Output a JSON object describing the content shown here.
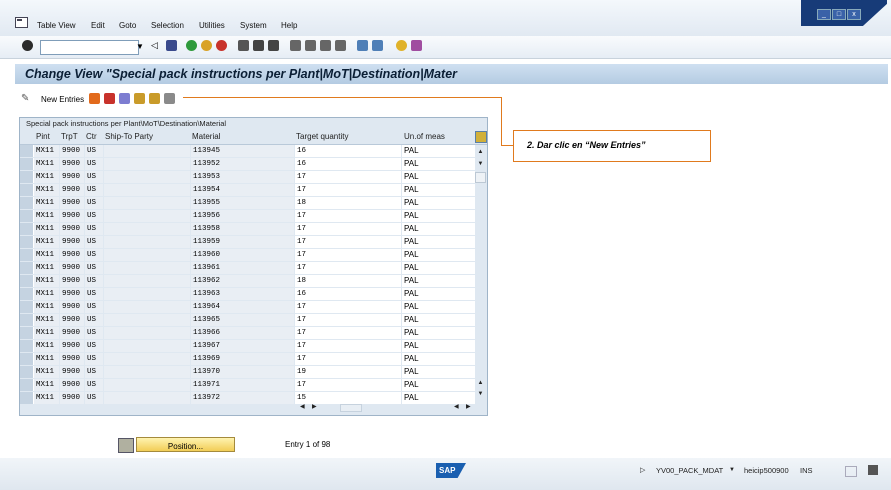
{
  "menu": [
    "Table View",
    "Edit",
    "Goto",
    "Selection",
    "Utilities",
    "System",
    "Help"
  ],
  "window_controls": [
    "_",
    "□",
    "x"
  ],
  "command_field": {
    "value": ""
  },
  "title": "Change View \"Special pack instructions per Plant|MoT|Destination|Mater",
  "app_toolbar": {
    "new_entries": "New Entries"
  },
  "table": {
    "title": "Special pack instructions per Plant\\MoT\\Destination\\Material",
    "columns": [
      "Pint",
      "TrpT",
      "Ctr",
      "Ship-To Party",
      "Material",
      "Target quantity",
      "Un.of meas"
    ],
    "rows": [
      [
        "MX11",
        "9900",
        "US",
        "",
        "113945",
        "16",
        "PAL"
      ],
      [
        "MX11",
        "9900",
        "US",
        "",
        "113952",
        "16",
        "PAL"
      ],
      [
        "MX11",
        "9900",
        "US",
        "",
        "113953",
        "17",
        "PAL"
      ],
      [
        "MX11",
        "9900",
        "US",
        "",
        "113954",
        "17",
        "PAL"
      ],
      [
        "MX11",
        "9900",
        "US",
        "",
        "113955",
        "18",
        "PAL"
      ],
      [
        "MX11",
        "9900",
        "US",
        "",
        "113956",
        "17",
        "PAL"
      ],
      [
        "MX11",
        "9900",
        "US",
        "",
        "113958",
        "17",
        "PAL"
      ],
      [
        "MX11",
        "9900",
        "US",
        "",
        "113959",
        "17",
        "PAL"
      ],
      [
        "MX11",
        "9900",
        "US",
        "",
        "113960",
        "17",
        "PAL"
      ],
      [
        "MX11",
        "9900",
        "US",
        "",
        "113961",
        "17",
        "PAL"
      ],
      [
        "MX11",
        "9900",
        "US",
        "",
        "113962",
        "18",
        "PAL"
      ],
      [
        "MX11",
        "9900",
        "US",
        "",
        "113963",
        "16",
        "PAL"
      ],
      [
        "MX11",
        "9900",
        "US",
        "",
        "113964",
        "17",
        "PAL"
      ],
      [
        "MX11",
        "9900",
        "US",
        "",
        "113965",
        "17",
        "PAL"
      ],
      [
        "MX11",
        "9900",
        "US",
        "",
        "113966",
        "17",
        "PAL"
      ],
      [
        "MX11",
        "9900",
        "US",
        "",
        "113967",
        "17",
        "PAL"
      ],
      [
        "MX11",
        "9900",
        "US",
        "",
        "113969",
        "17",
        "PAL"
      ],
      [
        "MX11",
        "9900",
        "US",
        "",
        "113970",
        "19",
        "PAL"
      ],
      [
        "MX11",
        "9900",
        "US",
        "",
        "113971",
        "17",
        "PAL"
      ],
      [
        "MX11",
        "9900",
        "US",
        "",
        "113972",
        "15",
        "PAL"
      ]
    ]
  },
  "position_button": "Position...",
  "entry_info": "Entry 1 of 98",
  "callout": "2. Dar clic en “New Entries”",
  "status": {
    "logo": "SAP",
    "transaction": "YV00_PACK_MDAT",
    "server": "heicip500900",
    "mode": "INS"
  },
  "colors": {
    "callout_border": "#e07a1e",
    "title_bg": "#b4cbe2",
    "sap_blue": "#1a5fb0"
  }
}
